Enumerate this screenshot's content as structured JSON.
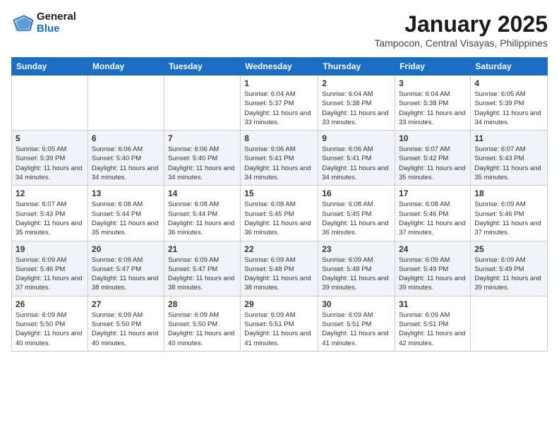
{
  "logo": {
    "line1": "General",
    "line2": "Blue"
  },
  "title": "January 2025",
  "location": "Tampocon, Central Visayas, Philippines",
  "days_of_week": [
    "Sunday",
    "Monday",
    "Tuesday",
    "Wednesday",
    "Thursday",
    "Friday",
    "Saturday"
  ],
  "weeks": [
    [
      {
        "day": "",
        "sunrise": "",
        "sunset": "",
        "daylight": ""
      },
      {
        "day": "",
        "sunrise": "",
        "sunset": "",
        "daylight": ""
      },
      {
        "day": "",
        "sunrise": "",
        "sunset": "",
        "daylight": ""
      },
      {
        "day": "1",
        "sunrise": "Sunrise: 6:04 AM",
        "sunset": "Sunset: 5:37 PM",
        "daylight": "Daylight: 11 hours and 33 minutes."
      },
      {
        "day": "2",
        "sunrise": "Sunrise: 6:04 AM",
        "sunset": "Sunset: 5:38 PM",
        "daylight": "Daylight: 11 hours and 33 minutes."
      },
      {
        "day": "3",
        "sunrise": "Sunrise: 6:04 AM",
        "sunset": "Sunset: 5:38 PM",
        "daylight": "Daylight: 11 hours and 33 minutes."
      },
      {
        "day": "4",
        "sunrise": "Sunrise: 6:05 AM",
        "sunset": "Sunset: 5:39 PM",
        "daylight": "Daylight: 11 hours and 34 minutes."
      }
    ],
    [
      {
        "day": "5",
        "sunrise": "Sunrise: 6:05 AM",
        "sunset": "Sunset: 5:39 PM",
        "daylight": "Daylight: 11 hours and 34 minutes."
      },
      {
        "day": "6",
        "sunrise": "Sunrise: 6:06 AM",
        "sunset": "Sunset: 5:40 PM",
        "daylight": "Daylight: 11 hours and 34 minutes."
      },
      {
        "day": "7",
        "sunrise": "Sunrise: 6:06 AM",
        "sunset": "Sunset: 5:40 PM",
        "daylight": "Daylight: 11 hours and 34 minutes."
      },
      {
        "day": "8",
        "sunrise": "Sunrise: 6:06 AM",
        "sunset": "Sunset: 5:41 PM",
        "daylight": "Daylight: 11 hours and 34 minutes."
      },
      {
        "day": "9",
        "sunrise": "Sunrise: 6:06 AM",
        "sunset": "Sunset: 5:41 PM",
        "daylight": "Daylight: 11 hours and 34 minutes."
      },
      {
        "day": "10",
        "sunrise": "Sunrise: 6:07 AM",
        "sunset": "Sunset: 5:42 PM",
        "daylight": "Daylight: 11 hours and 35 minutes."
      },
      {
        "day": "11",
        "sunrise": "Sunrise: 6:07 AM",
        "sunset": "Sunset: 5:43 PM",
        "daylight": "Daylight: 11 hours and 35 minutes."
      }
    ],
    [
      {
        "day": "12",
        "sunrise": "Sunrise: 6:07 AM",
        "sunset": "Sunset: 5:43 PM",
        "daylight": "Daylight: 11 hours and 35 minutes."
      },
      {
        "day": "13",
        "sunrise": "Sunrise: 6:08 AM",
        "sunset": "Sunset: 5:44 PM",
        "daylight": "Daylight: 11 hours and 35 minutes."
      },
      {
        "day": "14",
        "sunrise": "Sunrise: 6:08 AM",
        "sunset": "Sunset: 5:44 PM",
        "daylight": "Daylight: 11 hours and 36 minutes."
      },
      {
        "day": "15",
        "sunrise": "Sunrise: 6:08 AM",
        "sunset": "Sunset: 5:45 PM",
        "daylight": "Daylight: 11 hours and 36 minutes."
      },
      {
        "day": "16",
        "sunrise": "Sunrise: 6:08 AM",
        "sunset": "Sunset: 5:45 PM",
        "daylight": "Daylight: 11 hours and 36 minutes."
      },
      {
        "day": "17",
        "sunrise": "Sunrise: 6:08 AM",
        "sunset": "Sunset: 5:46 PM",
        "daylight": "Daylight: 11 hours and 37 minutes."
      },
      {
        "day": "18",
        "sunrise": "Sunrise: 6:09 AM",
        "sunset": "Sunset: 5:46 PM",
        "daylight": "Daylight: 11 hours and 37 minutes."
      }
    ],
    [
      {
        "day": "19",
        "sunrise": "Sunrise: 6:09 AM",
        "sunset": "Sunset: 5:46 PM",
        "daylight": "Daylight: 11 hours and 37 minutes."
      },
      {
        "day": "20",
        "sunrise": "Sunrise: 6:09 AM",
        "sunset": "Sunset: 5:47 PM",
        "daylight": "Daylight: 11 hours and 38 minutes."
      },
      {
        "day": "21",
        "sunrise": "Sunrise: 6:09 AM",
        "sunset": "Sunset: 5:47 PM",
        "daylight": "Daylight: 11 hours and 38 minutes."
      },
      {
        "day": "22",
        "sunrise": "Sunrise: 6:09 AM",
        "sunset": "Sunset: 5:48 PM",
        "daylight": "Daylight: 11 hours and 38 minutes."
      },
      {
        "day": "23",
        "sunrise": "Sunrise: 6:09 AM",
        "sunset": "Sunset: 5:48 PM",
        "daylight": "Daylight: 11 hours and 39 minutes."
      },
      {
        "day": "24",
        "sunrise": "Sunrise: 6:09 AM",
        "sunset": "Sunset: 5:49 PM",
        "daylight": "Daylight: 11 hours and 39 minutes."
      },
      {
        "day": "25",
        "sunrise": "Sunrise: 6:09 AM",
        "sunset": "Sunset: 5:49 PM",
        "daylight": "Daylight: 11 hours and 39 minutes."
      }
    ],
    [
      {
        "day": "26",
        "sunrise": "Sunrise: 6:09 AM",
        "sunset": "Sunset: 5:50 PM",
        "daylight": "Daylight: 11 hours and 40 minutes."
      },
      {
        "day": "27",
        "sunrise": "Sunrise: 6:09 AM",
        "sunset": "Sunset: 5:50 PM",
        "daylight": "Daylight: 11 hours and 40 minutes."
      },
      {
        "day": "28",
        "sunrise": "Sunrise: 6:09 AM",
        "sunset": "Sunset: 5:50 PM",
        "daylight": "Daylight: 11 hours and 40 minutes."
      },
      {
        "day": "29",
        "sunrise": "Sunrise: 6:09 AM",
        "sunset": "Sunset: 5:51 PM",
        "daylight": "Daylight: 11 hours and 41 minutes."
      },
      {
        "day": "30",
        "sunrise": "Sunrise: 6:09 AM",
        "sunset": "Sunset: 5:51 PM",
        "daylight": "Daylight: 11 hours and 41 minutes."
      },
      {
        "day": "31",
        "sunrise": "Sunrise: 6:09 AM",
        "sunset": "Sunset: 5:51 PM",
        "daylight": "Daylight: 11 hours and 42 minutes."
      },
      {
        "day": "",
        "sunrise": "",
        "sunset": "",
        "daylight": ""
      }
    ]
  ]
}
